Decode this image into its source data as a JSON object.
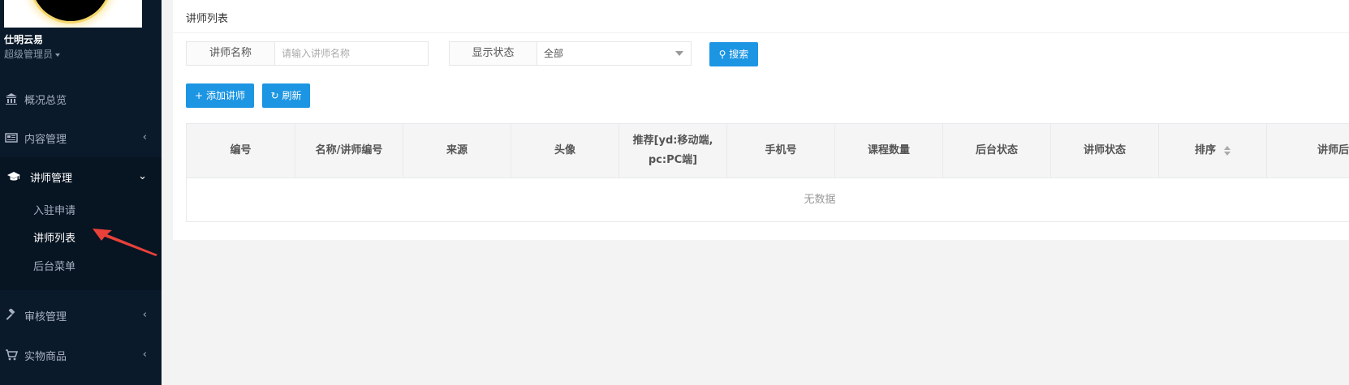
{
  "sidebar": {
    "user_name": "仕明云易",
    "user_role": "超级管理员",
    "items": [
      {
        "label": "概况总览",
        "icon": "bank-icon"
      },
      {
        "label": "内容管理",
        "icon": "newspaper-icon"
      },
      {
        "label": "讲师管理",
        "icon": "graduation-cap-icon"
      },
      {
        "label": "审核管理",
        "icon": "gavel-icon"
      },
      {
        "label": "实物商品",
        "icon": "cart-icon"
      }
    ],
    "sub_items": [
      "入驻申请",
      "讲师列表",
      "后台菜单"
    ]
  },
  "panel": {
    "title": "讲师列表"
  },
  "search": {
    "name_label": "讲师名称",
    "name_placeholder": "请输入讲师名称",
    "status_label": "显示状态",
    "status_value": "全部",
    "search_button": "搜索"
  },
  "toolbar": {
    "add_label": "添加讲师",
    "refresh_label": "刷新"
  },
  "table": {
    "columns": [
      "编号",
      "名称/讲师编号",
      "来源",
      "头像",
      "推荐[yd:移动端,",
      "pc:PC端]",
      "手机号",
      "课程数量",
      "后台状态",
      "讲师状态",
      "排序",
      "讲师后台"
    ],
    "empty_text": "无数据"
  },
  "colors": {
    "sidebar_bg": "#0b1a2a",
    "primary": "#1c95e3",
    "arrow": "#e8413a"
  }
}
